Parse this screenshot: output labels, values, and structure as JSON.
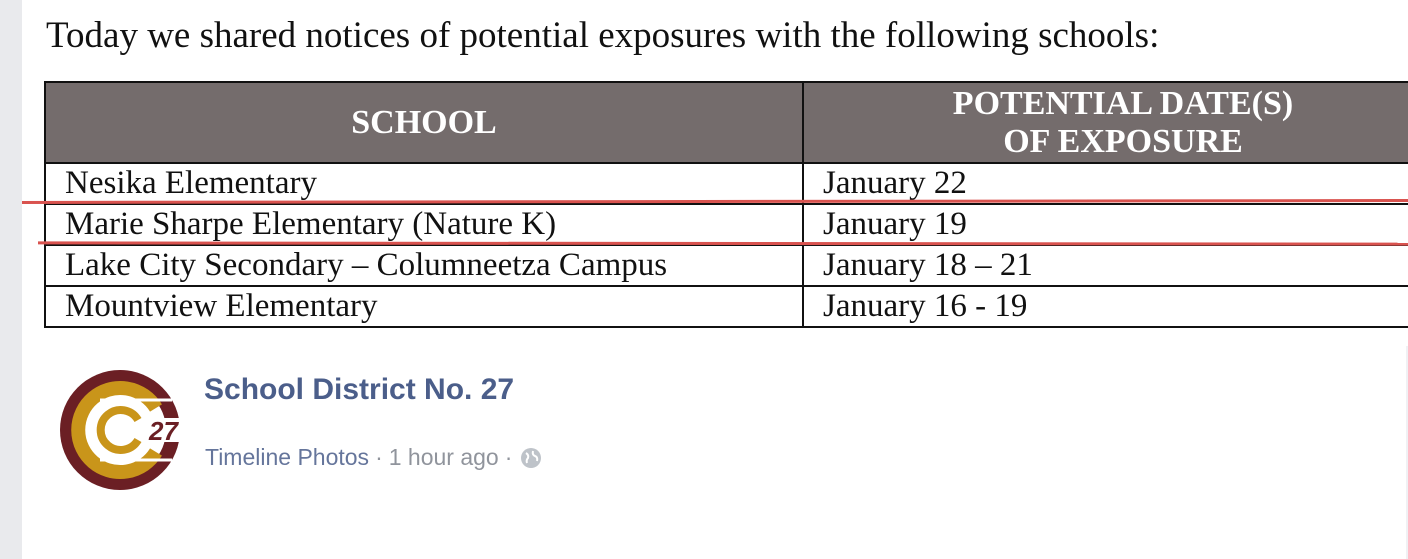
{
  "photo": {
    "intro": "Today we shared notices of potential exposures with the following schools:",
    "table": {
      "header_school": "SCHOOL",
      "header_date_line1": "POTENTIAL DATE(S)",
      "header_date_line2": "OF EXPOSURE",
      "rows": [
        {
          "school": "Nesika Elementary",
          "date": "January 22"
        },
        {
          "school": "Marie Sharpe Elementary (Nature K)",
          "date": "January 19"
        },
        {
          "school": "Lake City Secondary – Columneetza Campus",
          "date": "January 18 – 21"
        },
        {
          "school": "Mountview Elementary",
          "date": "January 16 - 19"
        }
      ]
    },
    "highlight_color": "#d9534f"
  },
  "post": {
    "page_name": "School District No. 27",
    "source": "Timeline Photos",
    "separator": "·",
    "time": "1 hour ago",
    "privacy_icon": "globe-icon",
    "logo": {
      "text": "27",
      "colors": {
        "ring": "#6b1f24",
        "gold": "#c9951a"
      }
    }
  }
}
